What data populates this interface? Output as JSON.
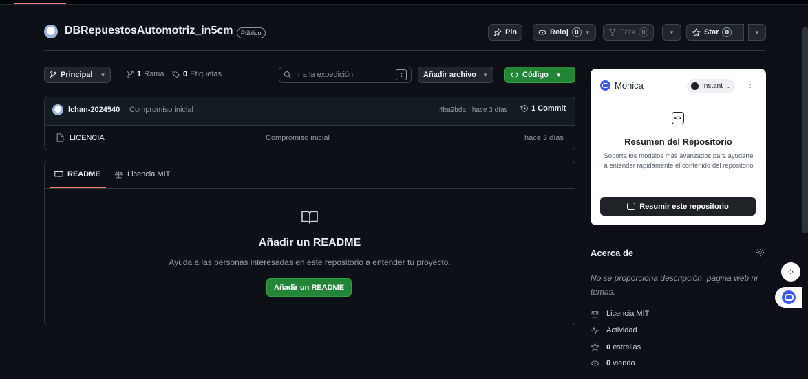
{
  "repo": {
    "name": "DBRepuestosAutomotriz_in5cm",
    "visibility": "Público"
  },
  "header_actions": {
    "pin": "Pin",
    "watch": "Reloj",
    "watch_count": "0",
    "fork": "Fork",
    "fork_count": "0",
    "star": "Star",
    "star_count": "0"
  },
  "toolbar": {
    "branch": "Principal",
    "branches_count": "1",
    "branches_label": "Rama",
    "tags_count": "0",
    "tags_label": "Etiquetas",
    "search_placeholder": "Ir a la expedición",
    "search_key": "t",
    "add_file": "Añadir archivo",
    "code": "Código"
  },
  "commit": {
    "author": "lchan-2024540",
    "message": "Compromiso inicial",
    "hash_time": "4ba9bda · hace 3 días",
    "commits": "1 Commit"
  },
  "files": [
    {
      "name": "LICENCIA",
      "message": "Compromiso inicial",
      "time": "hace 3 días"
    }
  ],
  "readme": {
    "tab_readme": "README",
    "tab_license": "Licencia MIT",
    "title": "Añadir un README",
    "description": "Ayuda a las personas interesadas en este repositorio a entender tu proyecto.",
    "button": "Añadir un README"
  },
  "monica": {
    "brand": "Monica",
    "mode": "Instant",
    "title": "Resumen del Repositorio",
    "description": "Soporta los modelos más avanzados para ayudarte a entender rápidamente el contenido del repositorio",
    "button": "Resumir este repositorio"
  },
  "about": {
    "heading": "Acerca de",
    "description": "No se proporciona descripción, página web ni temas.",
    "license": "Licencia MIT",
    "activity": "Actividad",
    "stars_count": "0",
    "stars_label": "estrellas",
    "watching_count": "0",
    "watching_label": "viendo"
  },
  "colors": {
    "background": "#0d1117",
    "border": "#30363d",
    "accent_green": "#238636",
    "tab_underline": "#f78166",
    "monica_blue": "#3b5bfc"
  }
}
